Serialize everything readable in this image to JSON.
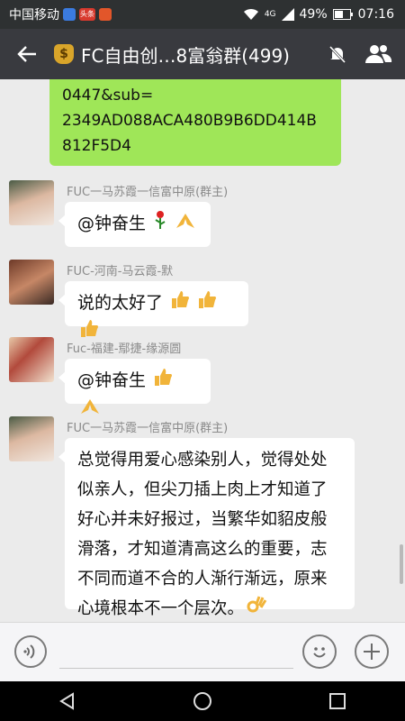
{
  "status": {
    "carrier": "中国移动",
    "badge1": "头条",
    "signal": "4G",
    "battery": "49%",
    "time": "07:16"
  },
  "header": {
    "title": "FC自由创…8富翁群(499)"
  },
  "prev_message": {
    "lines": [
      "0447&sub=",
      "2349AD088ACA480B9B6DD414B",
      "812F5D4"
    ]
  },
  "messages": [
    {
      "sender": "FUC一马苏霞一信富中原(群主)",
      "text": "@钟奋生 "
    },
    {
      "sender": "FUC-河南-马云霞-默",
      "text": "说的太好了"
    },
    {
      "sender": "Fuc-福建-鄢捷-缘源圆",
      "text": "@钟奋生 "
    },
    {
      "sender": "FUC一马苏霞一信富中原(群主)",
      "text": "总觉得用爱心感染别人，觉得处处似亲人，但尖刀插上肉上才知道了好心并未好报过，当繁华如貂皮般滑落，才知道清高这么的重要，志不同而道不合的人渐行渐远，原来心境根本不一个层次。"
    }
  ],
  "colors": {
    "titlebar": "#393a3f",
    "statusbar": "#2e3132",
    "chat_bg": "#ebebeb",
    "sent_bubble": "#9fe658"
  }
}
